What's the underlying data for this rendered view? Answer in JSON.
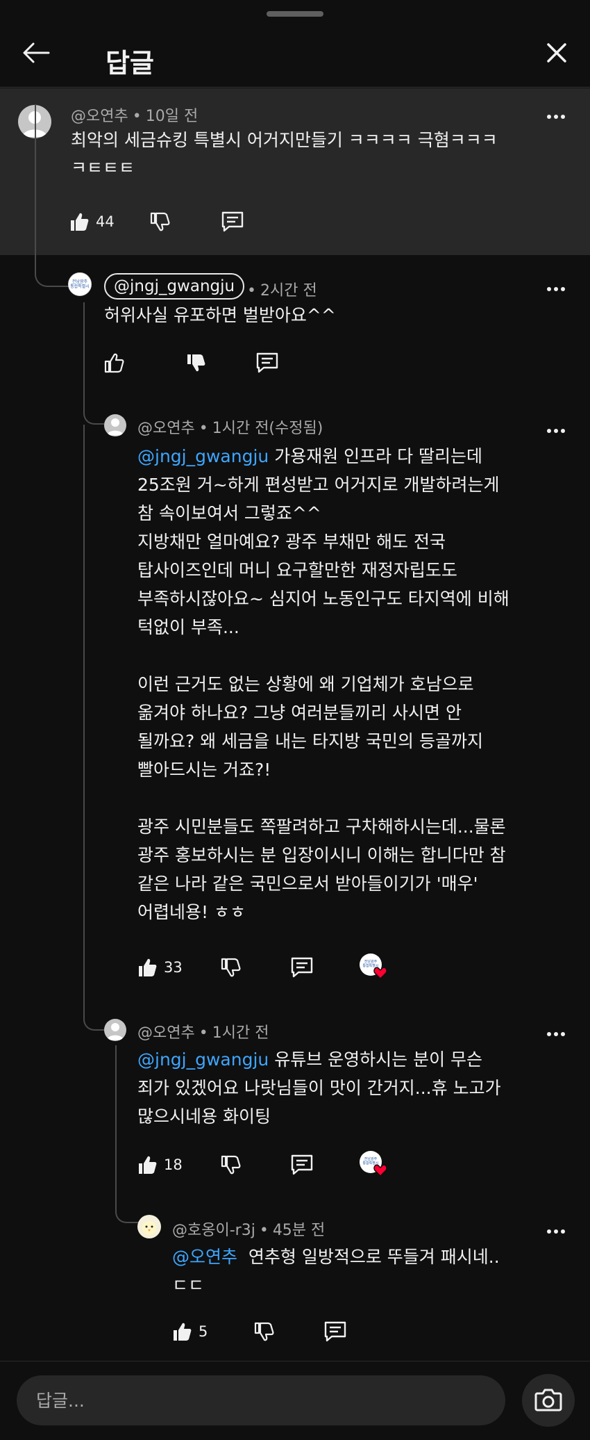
{
  "header": {
    "title": "답글"
  },
  "parent": {
    "author": "@오연추",
    "time": "10일 전",
    "text": "최악의 세금슈킹 특별시 어거지만들기 ㅋㅋㅋㅋ 극혐ㅋㅋㅋ\nㅋㅌㅌㅌ",
    "likes": "44"
  },
  "replies": [
    {
      "author": "@jngj_gwangju",
      "time": "2시간 전",
      "text": "허위사실 유포하면 벌받아요^^",
      "avatar_text": "전남광주\n통합특별시"
    },
    {
      "author": "@오연추",
      "time": "1시간 전(수정됨)",
      "mention": "@jngj_gwangju",
      "text_after_mention": " 가용재원 인프라 다 딸리는데\n25조원 거~하게 편성받고 어거지로 개발하려는게\n참 속이보여서 그렇죠^^\n지방채만 얼마예요? 광주 부채만 해도 전국\n탑사이즈인데 머니 요구할만한 재정자립도도\n부족하시잖아요~ 심지어 노동인구도 타지역에 비해\n턱없이 부족...\n\n이런 근거도 없는 상황에 왜 기업체가 호남으로\n옮겨야 하나요? 그냥 여러분들끼리 사시면 안\n될까요? 왜 세금을 내는 타지방 국민의 등골까지\n빨아드시는 거죠?!\n\n광주 시민분들도 쪽팔려하고 구차해하시는데...물론\n광주 홍보하시는 분 입장이시니 이해는 합니다만 참\n같은 나라 같은 국민으로서 받아들이기가 '매우'\n어렵네용! ㅎㅎ",
      "likes": "33"
    },
    {
      "author": "@오연추",
      "time": "1시간 전",
      "mention": "@jngj_gwangju",
      "text_after_mention": " 유튜브 운영하시는 분이 무슨\n죄가 있겠어요 나랏님들이 맛이 간거지...휴 노고가\n많으시네용 화이팅",
      "likes": "18"
    },
    {
      "author": "@호옹이-r3j",
      "time": "45분 전",
      "mention": "@오연추",
      "text_after_mention": "  연추형 일방적으로 뚜들겨 패시네..\nㄷㄷ",
      "likes": "5"
    }
  ],
  "composer": {
    "placeholder": "답글..."
  },
  "icons": {
    "back": "arrow-left-icon",
    "close": "close-icon",
    "more": "more-vertical-icon",
    "like": "thumb-up-icon",
    "dislike": "thumb-down-icon",
    "reply": "comment-icon",
    "camera": "camera-icon",
    "heart": "heart-icon"
  },
  "colors": {
    "background": "#0f0f0f",
    "highlight": "#282828",
    "mention": "#3ea6ff",
    "heart": "#ff0033"
  }
}
